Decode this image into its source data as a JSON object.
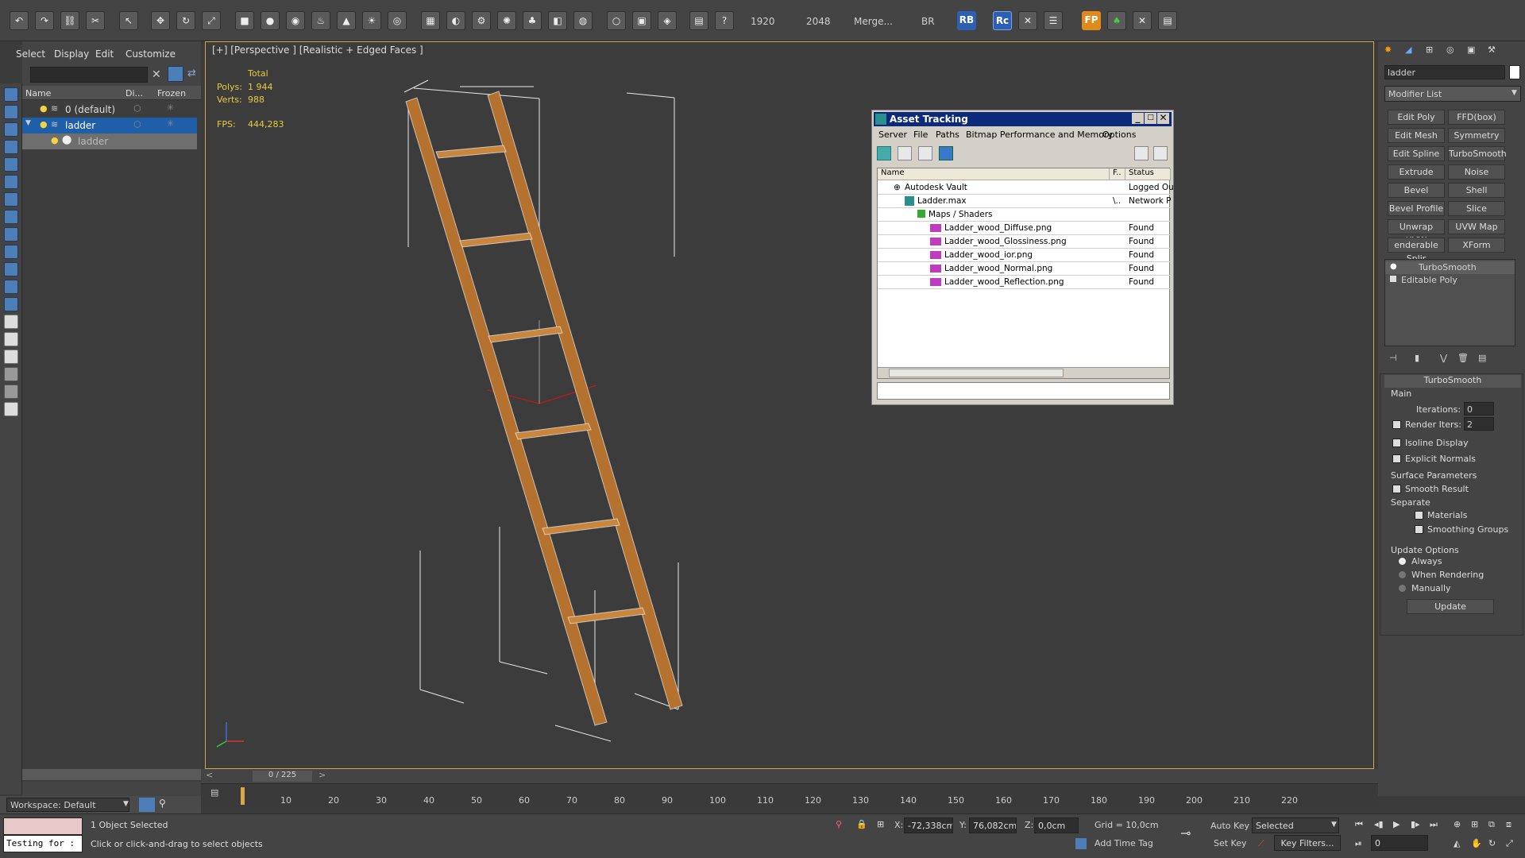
{
  "toolbar": {
    "render_width": "1920",
    "render_height": "2048",
    "merge_label": "Merge...",
    "br_label": "BR",
    "rb_label": "RB",
    "rc_label": "Rc",
    "fp_label": "FP"
  },
  "explorer": {
    "menu": [
      "Select",
      "Display",
      "Edit",
      "Customize"
    ],
    "columns": {
      "name": "Name",
      "display": "Di...",
      "frozen": "Frozen"
    },
    "rows": [
      {
        "label": "0 (default)"
      },
      {
        "label": "ladder"
      },
      {
        "label": "ladder"
      }
    ],
    "workspace": "Workspace: Default"
  },
  "viewport": {
    "label": "[+] [Perspective ] [Realistic + Edged Faces ]",
    "stats": {
      "total_label": "Total",
      "polys_label": "Polys:",
      "polys_value": "1 944",
      "verts_label": "Verts:",
      "verts_value": "988",
      "fps_label": "FPS:",
      "fps_value": "444,283"
    }
  },
  "asset_tracking": {
    "title": "Asset Tracking",
    "menu": [
      "Server",
      "File",
      "Paths",
      "Bitmap Performance and Memory",
      "Options"
    ],
    "columns": {
      "name": "Name",
      "f": "F..",
      "status": "Status"
    },
    "rows": [
      {
        "name": "Autodesk Vault",
        "f": "",
        "status": "Logged Ou"
      },
      {
        "name": "Ladder.max",
        "f": "\\..",
        "status": "Network P"
      },
      {
        "name": "Maps / Shaders",
        "f": "",
        "status": ""
      },
      {
        "name": "Ladder_wood_Diffuse.png",
        "f": "",
        "status": "Found"
      },
      {
        "name": "Ladder_wood_Glossiness.png",
        "f": "",
        "status": "Found"
      },
      {
        "name": "Ladder_wood_ior.png",
        "f": "",
        "status": "Found"
      },
      {
        "name": "Ladder_wood_Normal.png",
        "f": "",
        "status": "Found"
      },
      {
        "name": "Ladder_wood_Reflection.png",
        "f": "",
        "status": "Found"
      }
    ]
  },
  "command_panel": {
    "object_name": "ladder",
    "modifier_list": "Modifier List",
    "buttons": [
      "Edit Poly",
      "FFD(box)",
      "Edit Mesh",
      "Symmetry",
      "Edit Spline",
      "TurboSmooth",
      "Extrude",
      "Noise",
      "Bevel",
      "Shell",
      "Bevel Profile",
      "Slice",
      "Unwrap UVW",
      "UVW Map",
      "enderable Splir",
      "XForm"
    ],
    "stack": [
      "TurboSmooth",
      "Editable Poly"
    ],
    "rollout_title": "TurboSmooth",
    "main_label": "Main",
    "iterations_label": "Iterations:",
    "iterations_value": "0",
    "render_iters_label": "Render Iters:",
    "render_iters_value": "2",
    "isoline_label": "Isoline Display",
    "explicit_label": "Explicit Normals",
    "surface_label": "Surface Parameters",
    "smooth_label": "Smooth Result",
    "separate_label": "Separate",
    "materials_label": "Materials",
    "smoothing_label": "Smoothing Groups",
    "update_options_label": "Update Options",
    "always_label": "Always",
    "when_rendering_label": "When Rendering",
    "manually_label": "Manually",
    "update_button": "Update"
  },
  "timeline": {
    "frame": "0 / 225",
    "ticks": [
      "10",
      "20",
      "30",
      "40",
      "50",
      "60",
      "70",
      "80",
      "90",
      "100",
      "110",
      "120",
      "130",
      "140",
      "150",
      "160",
      "170",
      "180",
      "190",
      "200",
      "210",
      "220"
    ]
  },
  "status": {
    "script_text": "Testing for :",
    "selected": "1 Object Selected",
    "prompt": "Click or click-and-drag to select objects",
    "x_label": "X:",
    "x_value": "-72,338cm",
    "y_label": "Y:",
    "y_value": "76,082cm",
    "z_label": "Z:",
    "z_value": "0,0cm",
    "grid": "Grid = 10,0cm",
    "add_time_tag": "Add Time Tag",
    "auto_key": "Auto Key",
    "selected_dropdown": "Selected",
    "set_key": "Set Key",
    "key_filters": "Key Filters...",
    "frame_field": "0"
  },
  "colors": {
    "accent": "#d7a84a",
    "selection": "#1f5ea8",
    "ladder": "#b5722f"
  }
}
